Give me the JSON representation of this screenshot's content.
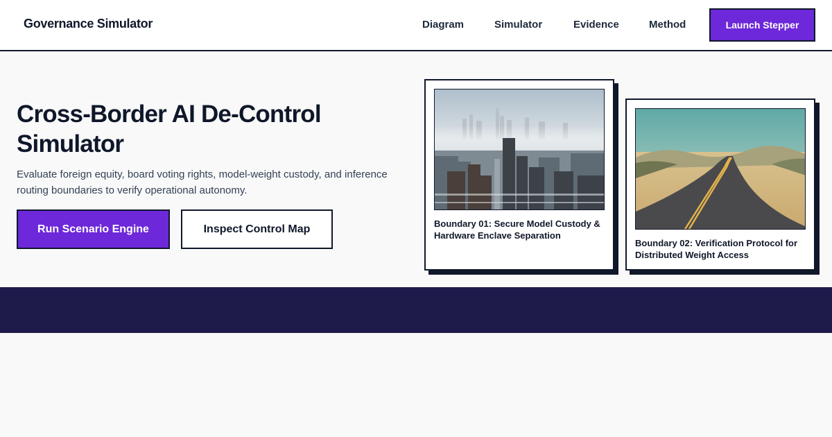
{
  "header": {
    "brand": "Governance Simulator",
    "nav": [
      {
        "label": "Diagram"
      },
      {
        "label": "Simulator"
      },
      {
        "label": "Evidence"
      },
      {
        "label": "Method"
      }
    ],
    "cta_label": "Launch Stepper"
  },
  "hero": {
    "title": "Cross-Border AI De-Control Simulator",
    "subtitle": "Evaluate foreign equity, board voting rights, model-weight custody, and inference routing boundaries to verify operational autonomy.",
    "primary_button": "Run Scenario Engine",
    "secondary_button": "Inspect Control Map"
  },
  "cards": [
    {
      "image": "foggy-city-skyline-photo",
      "caption": "Boundary 01: Secure Model Custody & Hardware Enclave Separation"
    },
    {
      "image": "desert-road-photo",
      "caption": "Boundary 02: Verification Protocol for Distributed Weight Access"
    }
  ],
  "colors": {
    "accent": "#6d28d9",
    "ink": "#0f172a",
    "band": "#1e1b4b",
    "background": "#f9f9f9"
  }
}
